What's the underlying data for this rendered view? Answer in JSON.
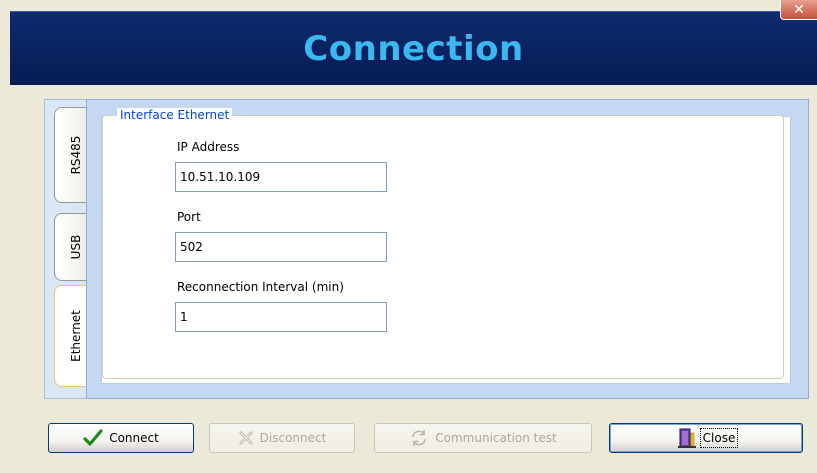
{
  "window": {
    "title": "Connection",
    "close_glyph": "✕"
  },
  "tabs": [
    {
      "label": "RS485",
      "active": false,
      "icon": "none"
    },
    {
      "label": "USB",
      "active": false,
      "icon": "none"
    },
    {
      "label": "Ethernet",
      "active": true,
      "icon": "none"
    }
  ],
  "group": {
    "legend": "Interface Ethernet"
  },
  "fields": {
    "ip": {
      "label": "IP Address",
      "value": "10.51.10.109"
    },
    "port": {
      "label": "Port",
      "value": "502"
    },
    "interval": {
      "label": "Reconnection Interval (min)",
      "value": "1"
    }
  },
  "buttons": {
    "connect": {
      "label": "Connect",
      "icon": "checkmark-icon",
      "enabled": true
    },
    "disconnect": {
      "label": "Disconnect",
      "icon": "disconnect-x-icon",
      "enabled": false
    },
    "communication_test": {
      "label": "Communication test",
      "icon": "refresh-icon",
      "enabled": false
    },
    "close": {
      "label": "Close",
      "icon": "door-exit-icon",
      "enabled": true
    }
  },
  "colors": {
    "title_bar": "#0a2260",
    "title_text": "#3cb8f0",
    "legend_text": "#0046d5",
    "panel_blue": "#c4d8f2",
    "check_green": "#1a8a1a"
  }
}
